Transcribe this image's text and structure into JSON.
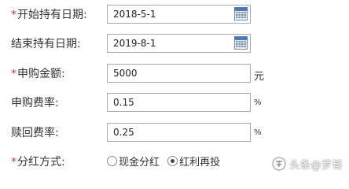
{
  "form": {
    "start_date": {
      "required": "*",
      "label": "开始持有日期:",
      "value": "2018-5-1"
    },
    "end_date": {
      "label": "结束持有日期:",
      "value": "2019-8-1"
    },
    "amount": {
      "required": "*",
      "label": "申购金额:",
      "value": "5000",
      "unit": "元"
    },
    "purchase_fee": {
      "label": "申购费率:",
      "value": "0.15",
      "unit": "%"
    },
    "redeem_fee": {
      "label": "赎回费率:",
      "value": "0.25",
      "unit": "%"
    },
    "dividend": {
      "required": "*",
      "label": "分红方式:",
      "options": [
        {
          "label": "现金分红",
          "checked": false
        },
        {
          "label": "红利再投",
          "checked": true
        }
      ]
    }
  },
  "watermark": {
    "text": "头条@罗哥",
    "icon": "watermark-logo-icon"
  },
  "colors": {
    "required": "#d9322a",
    "border": "#a9a9a9",
    "text": "#333333"
  }
}
